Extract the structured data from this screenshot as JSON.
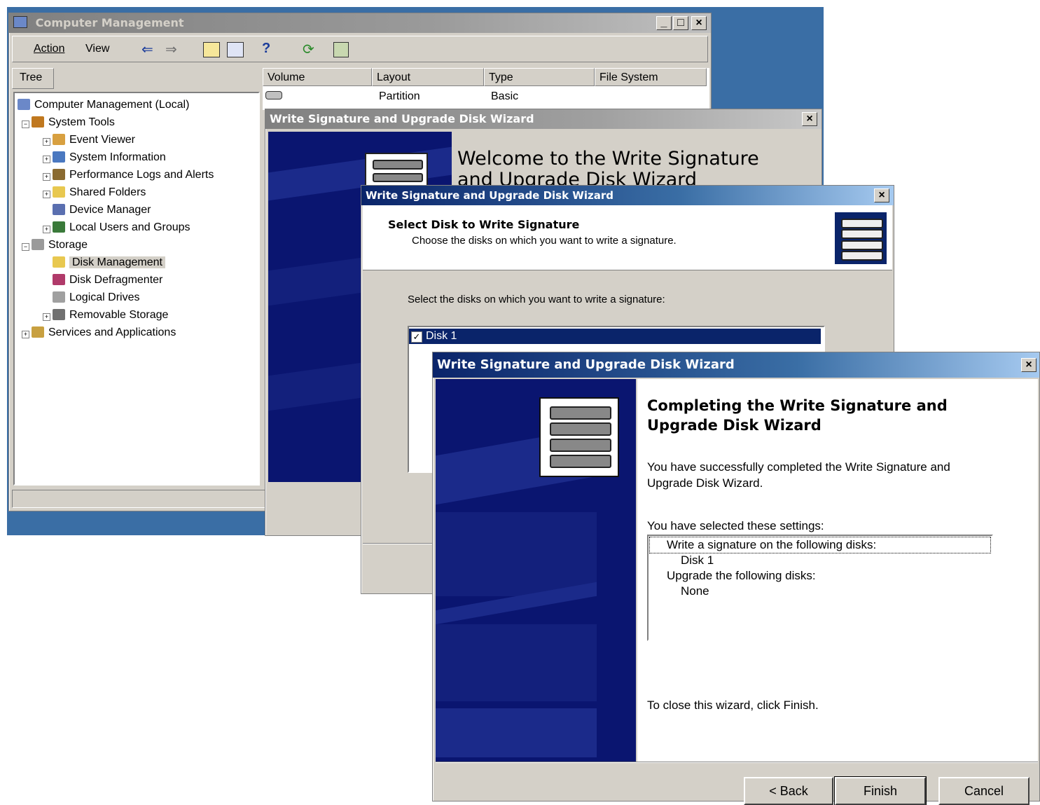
{
  "cm": {
    "title": "Computer Management",
    "menu": {
      "action": "Action",
      "view": "View"
    },
    "tree_tab": "Tree",
    "tree": {
      "root": "Computer Management (Local)",
      "system_tools": "System Tools",
      "event_viewer": "Event Viewer",
      "system_information": "System Information",
      "perf_logs": "Performance Logs and Alerts",
      "shared_folders": "Shared Folders",
      "device_manager": "Device Manager",
      "local_users": "Local Users and Groups",
      "storage": "Storage",
      "disk_management": "Disk Management",
      "disk_defrag": "Disk Defragmenter",
      "logical_drives": "Logical Drives",
      "removable_storage": "Removable Storage",
      "services_apps": "Services and Applications"
    },
    "columns": {
      "volume": "Volume",
      "layout": "Layout",
      "type": "Type",
      "file_system": "File System"
    },
    "row": {
      "layout": "Partition",
      "type": "Basic"
    }
  },
  "wizard1": {
    "title": "Write Signature and Upgrade Disk Wizard",
    "heading_line1": "Welcome to the Write Signature",
    "heading_line2": "and Upgrade Disk Wizard"
  },
  "wizard2": {
    "title": "Write Signature and Upgrade Disk Wizard",
    "header_title": "Select Disk to Write Signature",
    "header_subtitle": "Choose the disks on which you want to write a signature.",
    "prompt": "Select the disks on which you want to write a signature:",
    "disk_item": "Disk 1"
  },
  "wizard3": {
    "title": "Write Signature and Upgrade Disk Wizard",
    "heading_line1": "Completing the Write Signature and",
    "heading_line2": "Upgrade Disk Wizard",
    "success_line1": "You have successfully completed the Write Signature and",
    "success_line2": "Upgrade Disk Wizard.",
    "settings_label": "You have selected these settings:",
    "settings": {
      "line1": "Write a signature on the following disks:",
      "line2": "Disk 1",
      "line3": "Upgrade the following disks:",
      "line4": "None"
    },
    "close_hint": "To close this wizard, click Finish.",
    "buttons": {
      "back": "< Back",
      "finish": "Finish",
      "cancel": "Cancel"
    }
  },
  "colors": {
    "desktop_blue": "#3a6ea5",
    "titlebar_active": "#0a246a",
    "wizard_panel_navy": "#0a1570",
    "selection": "#0a246a"
  }
}
